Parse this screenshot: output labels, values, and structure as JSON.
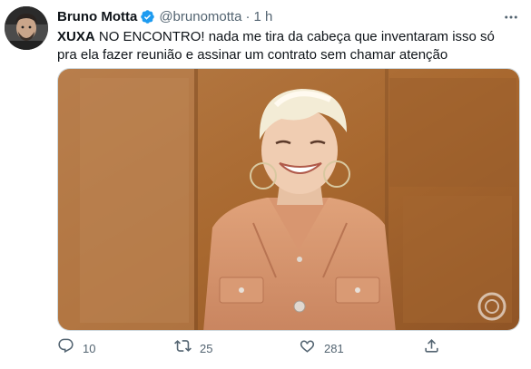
{
  "author": {
    "name": "Bruno Motta",
    "handle": "@brunomotta",
    "separator": "·",
    "time": "1 h",
    "avatar_icon": "profile-photo"
  },
  "tweet": {
    "text_bold": "XUXA",
    "text_rest": " NO ENCONTRO! nada me tira da cabeça que inventaram isso só pra ela fazer reunião e assinar um contrato sem chamar atenção"
  },
  "media": {
    "watermark": "tv-globo-logo"
  },
  "actions": {
    "reply_count": "10",
    "retweet_count": "25",
    "like_count": "281"
  },
  "colors": {
    "verified": "#1d9bf0",
    "secondary_text": "#536471"
  }
}
